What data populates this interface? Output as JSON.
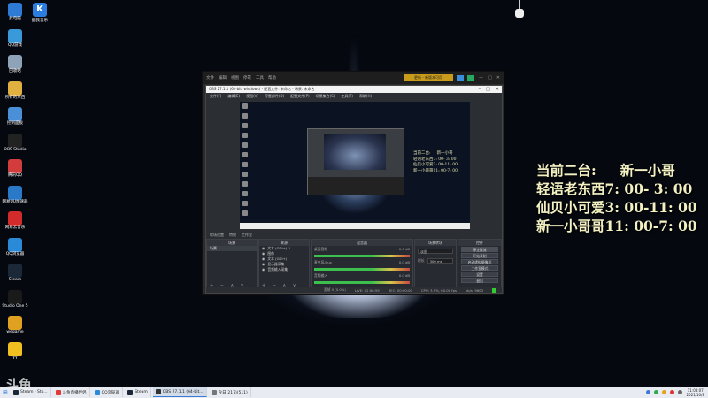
{
  "desktop": {
    "icons_col1": [
      {
        "label": "此电脑",
        "color": "#2d7bd4"
      },
      {
        "label": "QQ游戏",
        "color": "#3a9ad9"
      },
      {
        "label": "回收站",
        "color": "#8ea2b8"
      },
      {
        "label": "所有的东西",
        "color": "#e0b040"
      },
      {
        "label": "控制面板",
        "color": "#4a90d8"
      },
      {
        "label": "OBS Studio",
        "color": "#222222"
      },
      {
        "label": "腾讯QQ",
        "color": "#d23c3c"
      },
      {
        "label": "网易UU加速器",
        "color": "#2a78c8"
      },
      {
        "label": "网易云音乐",
        "color": "#d22b2b"
      },
      {
        "label": "QQ浏览器",
        "color": "#2a8ad8"
      },
      {
        "label": "Steam",
        "color": "#1b2838"
      },
      {
        "label": "Studio One 5",
        "color": "#1a1a1a"
      },
      {
        "label": "wegame",
        "color": "#e0a020"
      },
      {
        "label": "YY",
        "color": "#f0c020"
      }
    ],
    "icon_col2": {
      "label": "酷我音乐",
      "glyph": "K"
    }
  },
  "obs_outer": {
    "alert": "更新 - 新版本可用",
    "menu": [
      "文件",
      "编辑",
      "视图",
      "停靠",
      "工具",
      "帮助"
    ]
  },
  "obs_window": {
    "title": "OBS 27.1.1 (64-bit, windows) - 配置文件: 未命名 - 场景: 未命名",
    "menu": [
      "文件(F)",
      "编辑(E)",
      "视图(V)",
      "停靠部件(D)",
      "配置文件(P)",
      "场景集合(S)",
      "工具(T)",
      "帮助(H)"
    ],
    "scene_bar": [
      "转场设置",
      "特效",
      "工作室"
    ],
    "docks": {
      "scenes_title": "场景",
      "scenes": [
        "场景"
      ],
      "sources_title": "来源",
      "sources": [
        "文本 (GDI+) 2",
        "图像",
        "文本 (GDI+)",
        "显示器采集",
        "音频输入采集"
      ],
      "mixer_title": "混音器",
      "mixer": [
        {
          "name": "桌面音频",
          "db": "0.0 dB"
        },
        {
          "name": "麦克风/Aux",
          "db": "0.0 dB"
        },
        {
          "name": "音频输入",
          "db": "0.0 dB"
        }
      ],
      "transitions_title": "场景转场",
      "transition_type": "淡出",
      "duration_label": "时长",
      "duration": "300 ms",
      "controls_title": "控件",
      "controls": [
        "停止推流",
        "开始录制",
        "启动虚拟摄像机",
        "工作室模式",
        "设置",
        "退出"
      ],
      "footer": "+ − ∧ ∨"
    },
    "status": [
      "丢帧 0 (0.0%)",
      "LIVE: 02:06:59",
      "REC: 00:00:00",
      "CPU: 3.9%, 60.00 fps",
      "kb/s: 9603"
    ]
  },
  "overlay": {
    "lines": [
      "当前二台:     新一小哥",
      "轻语老东西7: 00- 3: 00",
      "仙贝小可爱3: 00-11: 00",
      "新一小哥哥11: 00-7: 00"
    ]
  },
  "watermark": "斗鱼",
  "taskbar": {
    "items": [
      {
        "label": "Steam - Sto...",
        "color": "#1b2838"
      },
      {
        "label": "斗鱼直播伴侣",
        "color": "#e23a3a"
      },
      {
        "label": "QQ浏览器",
        "color": "#2a8ad8"
      },
      {
        "label": "Steam",
        "color": "#1b2838"
      },
      {
        "label": "OBS 27.1.1 (64-bit...",
        "color": "#333333",
        "active": true
      },
      {
        "label": "今日(217)(511)",
        "color": "#777777"
      }
    ],
    "time": "11:08:07",
    "date": "2021/10/8"
  }
}
